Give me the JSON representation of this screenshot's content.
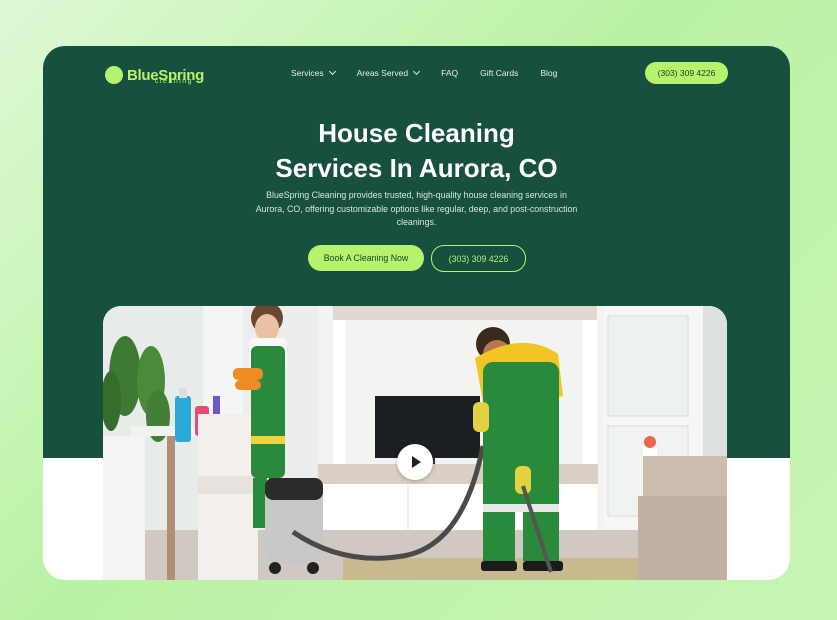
{
  "logo": {
    "name": "BlueSpring",
    "sub": "cleaning"
  },
  "nav": {
    "items": [
      {
        "label": "Services",
        "dropdown": true
      },
      {
        "label": "Areas Served",
        "dropdown": true
      },
      {
        "label": "FAQ",
        "dropdown": false
      },
      {
        "label": "Gift Cards",
        "dropdown": false
      },
      {
        "label": "Blog",
        "dropdown": false
      }
    ],
    "phone": "(303) 309 4226"
  },
  "hero": {
    "title_line1": "House Cleaning",
    "title_line2": "Services In Aurora, CO",
    "subtitle": "BlueSpring Cleaning provides trusted, high-quality house cleaning services in Aurora, CO, offering customizable options like regular, deep, and post-construction cleanings.",
    "book_label": "Book A Cleaning Now",
    "phone_label": "(303) 309 4226"
  },
  "media": {
    "icon": "play-icon"
  },
  "colors": {
    "brand_dark": "#17503f",
    "accent": "#b7f26d"
  }
}
